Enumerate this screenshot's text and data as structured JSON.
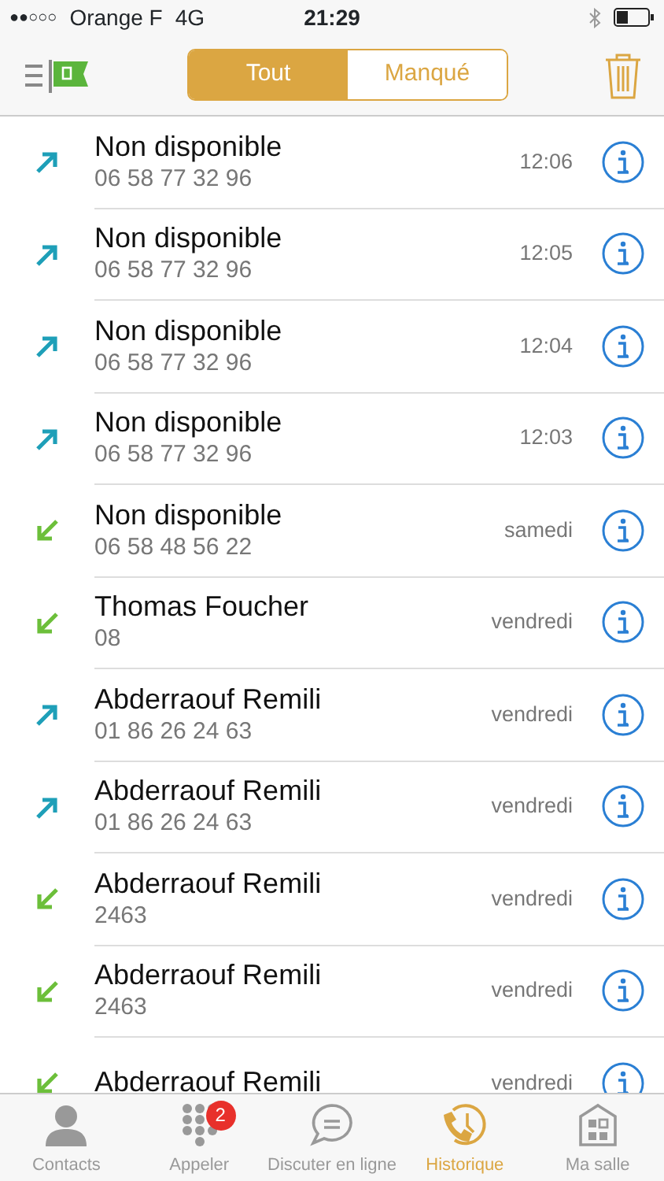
{
  "status_bar": {
    "signal": "●●○○○",
    "carrier": "Orange F",
    "network": "4G",
    "time": "21:29"
  },
  "segments": [
    {
      "label": "Tout",
      "selected": true
    },
    {
      "label": "Manqué",
      "selected": false
    }
  ],
  "calls": [
    {
      "kind": "outgoing",
      "name": "Non disponible",
      "number": "06 58 77 32 96",
      "time": "12:06"
    },
    {
      "kind": "outgoing",
      "name": "Non disponible",
      "number": "06 58 77 32 96",
      "time": "12:05"
    },
    {
      "kind": "outgoing",
      "name": "Non disponible",
      "number": "06 58 77 32 96",
      "time": "12:04"
    },
    {
      "kind": "outgoing",
      "name": "Non disponible",
      "number": "06 58 77 32 96",
      "time": "12:03"
    },
    {
      "kind": "incoming",
      "name": "Non disponible",
      "number": "06 58 48 56 22",
      "time": "samedi"
    },
    {
      "kind": "incoming",
      "name": "Thomas Foucher",
      "number": "08",
      "time": "vendredi"
    },
    {
      "kind": "outgoing",
      "name": "Abderraouf Remili",
      "number": "01 86 26 24 63",
      "time": "vendredi"
    },
    {
      "kind": "outgoing",
      "name": "Abderraouf Remili",
      "number": "01 86 26 24 63",
      "time": "vendredi"
    },
    {
      "kind": "incoming",
      "name": "Abderraouf Remili",
      "number": "2463",
      "time": "vendredi"
    },
    {
      "kind": "incoming",
      "name": "Abderraouf Remili",
      "number": "2463",
      "time": "vendredi"
    },
    {
      "kind": "incoming",
      "name": "Abderraouf Remili",
      "time": "vendredi"
    }
  ],
  "tab_bar": [
    {
      "kind": "contacts",
      "label": "Contacts",
      "selected": false
    },
    {
      "kind": "dialpad",
      "label": "Appeler",
      "selected": false,
      "badge": "2"
    },
    {
      "kind": "chat",
      "label": "Discuter en ligne",
      "selected": false
    },
    {
      "kind": "history",
      "label": "Historique",
      "selected": true
    },
    {
      "kind": "room",
      "label": "Ma salle",
      "selected": false
    }
  ]
}
